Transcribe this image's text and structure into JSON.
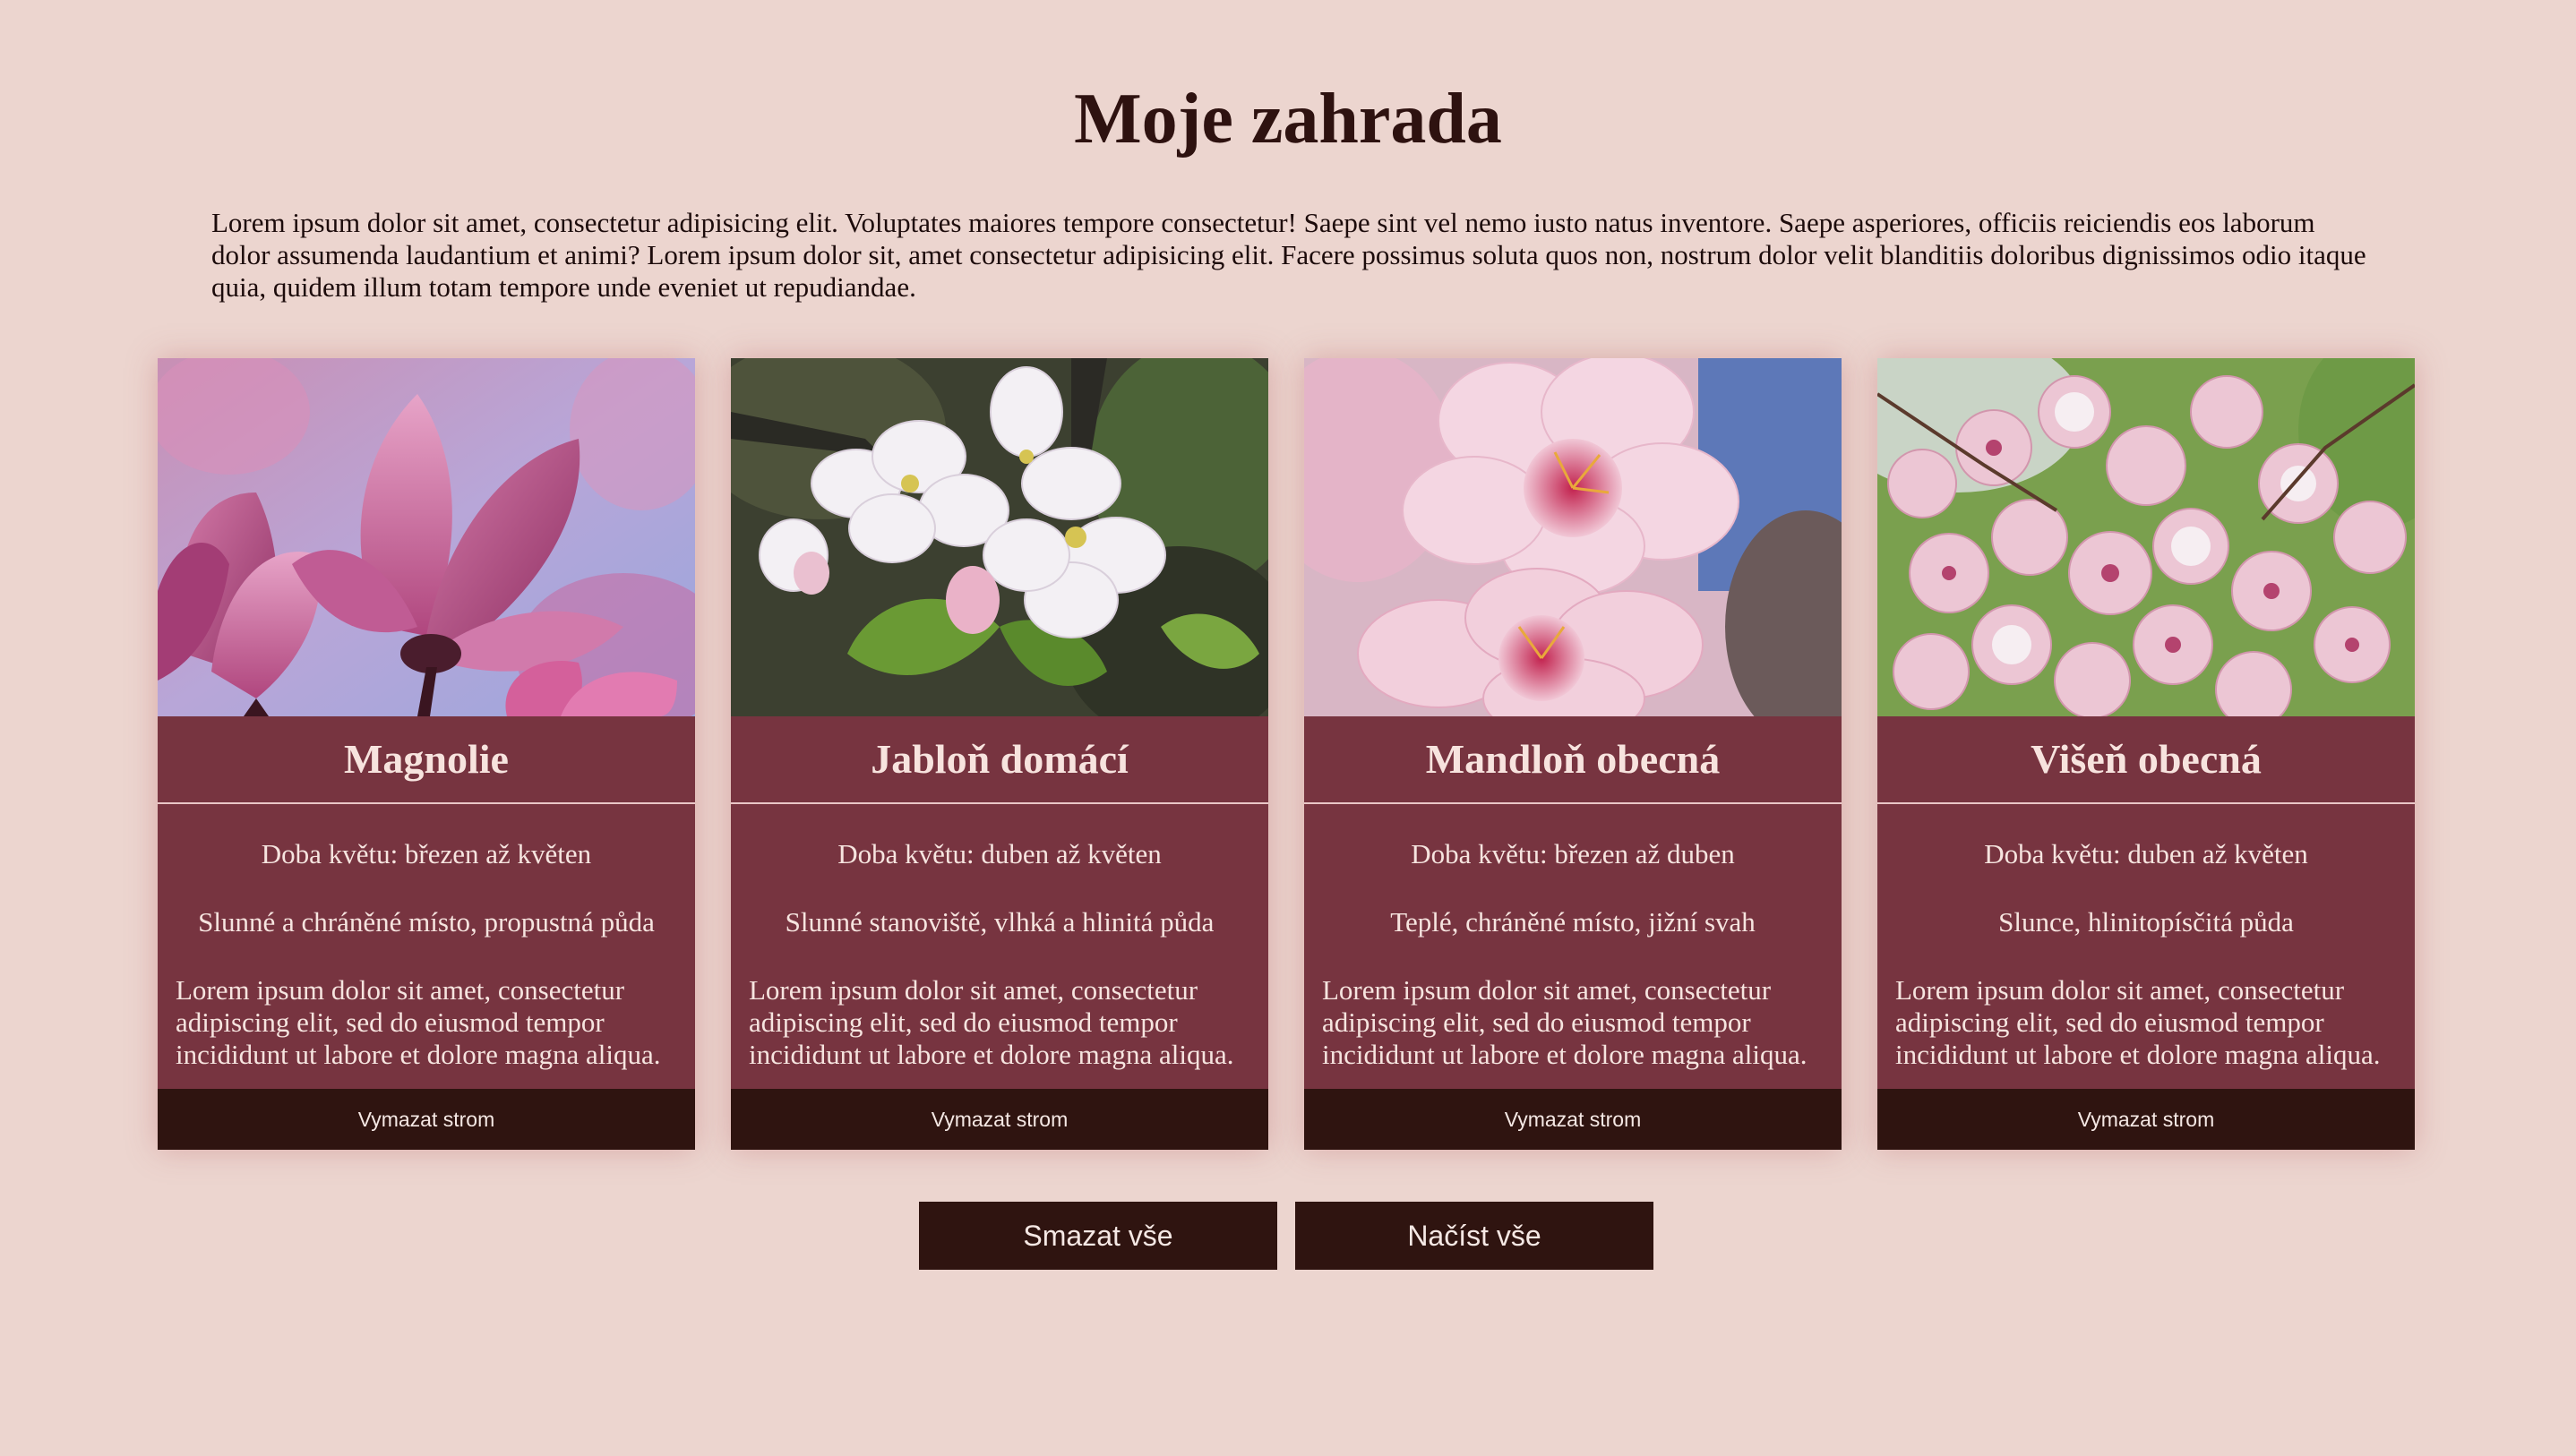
{
  "page": {
    "title": "Moje zahrada",
    "intro": "Lorem ipsum dolor sit amet, consectetur adipisicing elit. Voluptates maiores tempore consectetur! Saepe sint vel nemo iusto natus inventore. Saepe asperiores, officiis reiciendis eos laborum dolor assumenda laudantium et animi? Lorem ipsum dolor sit, amet consectetur adipisicing elit. Facere possimus soluta quos non, nostrum dolor velit blanditiis doloribus dignissimos odio itaque quia, quidem illum totam tempore unde eveniet ut repudiandae."
  },
  "colors": {
    "background": "#ecd5cf",
    "card": "#773440",
    "button": "#2f1410",
    "heading": "#2e1210"
  },
  "cards": [
    {
      "name": "Magnolie",
      "bloom": "Doba květu: březen až květen",
      "site": "Slunné a chráněné místo, propustná půda",
      "description": "Lorem ipsum dolor sit amet, consectetur adipiscing elit, sed do eiusmod tempor incididunt ut labore et dolore magna aliqua.",
      "delete_label": "Vymazat strom",
      "image": "magnolia-photo"
    },
    {
      "name": "Jabloň domácí",
      "bloom": "Doba květu: duben až květen",
      "site": "Slunné stanoviště, vlhká a hlinitá půda",
      "description": "Lorem ipsum dolor sit amet, consectetur adipiscing elit, sed do eiusmod tempor incididunt ut labore et dolore magna aliqua.",
      "delete_label": "Vymazat strom",
      "image": "apple-blossom-photo"
    },
    {
      "name": "Mandloň obecná",
      "bloom": "Doba květu: březen až duben",
      "site": "Teplé, chráněné místo, jižní svah",
      "description": "Lorem ipsum dolor sit amet, consectetur adipiscing elit, sed do eiusmod tempor incididunt ut labore et dolore magna aliqua.",
      "delete_label": "Vymazat strom",
      "image": "almond-blossom-photo"
    },
    {
      "name": "Višeň obecná",
      "bloom": "Doba květu: duben až květen",
      "site": "Slunce, hlinitopísčitá půda",
      "description": "Lorem ipsum dolor sit amet, consectetur adipiscing elit, sed do eiusmod tempor incididunt ut labore et dolore magna aliqua.",
      "delete_label": "Vymazat strom",
      "image": "cherry-blossom-photo"
    }
  ],
  "actions": {
    "clear_all": "Smazat vše",
    "load_all": "Načíst vše"
  }
}
